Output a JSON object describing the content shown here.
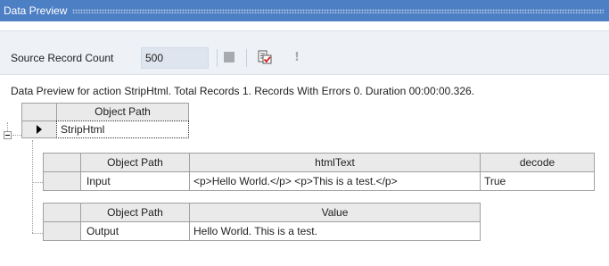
{
  "titlebar": {
    "title": "Data Preview"
  },
  "toolbar": {
    "source_label": "Source Record Count",
    "source_value": "500",
    "icons": [
      "stop-icon",
      "preview-run-icon",
      "error-info-icon"
    ],
    "excl_glyph": "!"
  },
  "status": {
    "text": "Data Preview for action StripHtml. Total Records 1. Records With Errors 0. Duration 00:00:00.326."
  },
  "grid": {
    "outer_header": "Object Path",
    "outer_row": "StripHtml",
    "input_table": {
      "headers": [
        "Object Path",
        "htmlText",
        "decode"
      ],
      "row": [
        "Input",
        "<p>Hello World.</p> <p>This is a test.</p>",
        "True"
      ]
    },
    "output_table": {
      "headers": [
        "Object Path",
        "Value"
      ],
      "row": [
        "Output",
        "Hello World. This is a test."
      ]
    }
  },
  "colors": {
    "titlebar": "#4d7fc4",
    "toolbar": "#eef1f6",
    "header": "#eaeaea"
  }
}
